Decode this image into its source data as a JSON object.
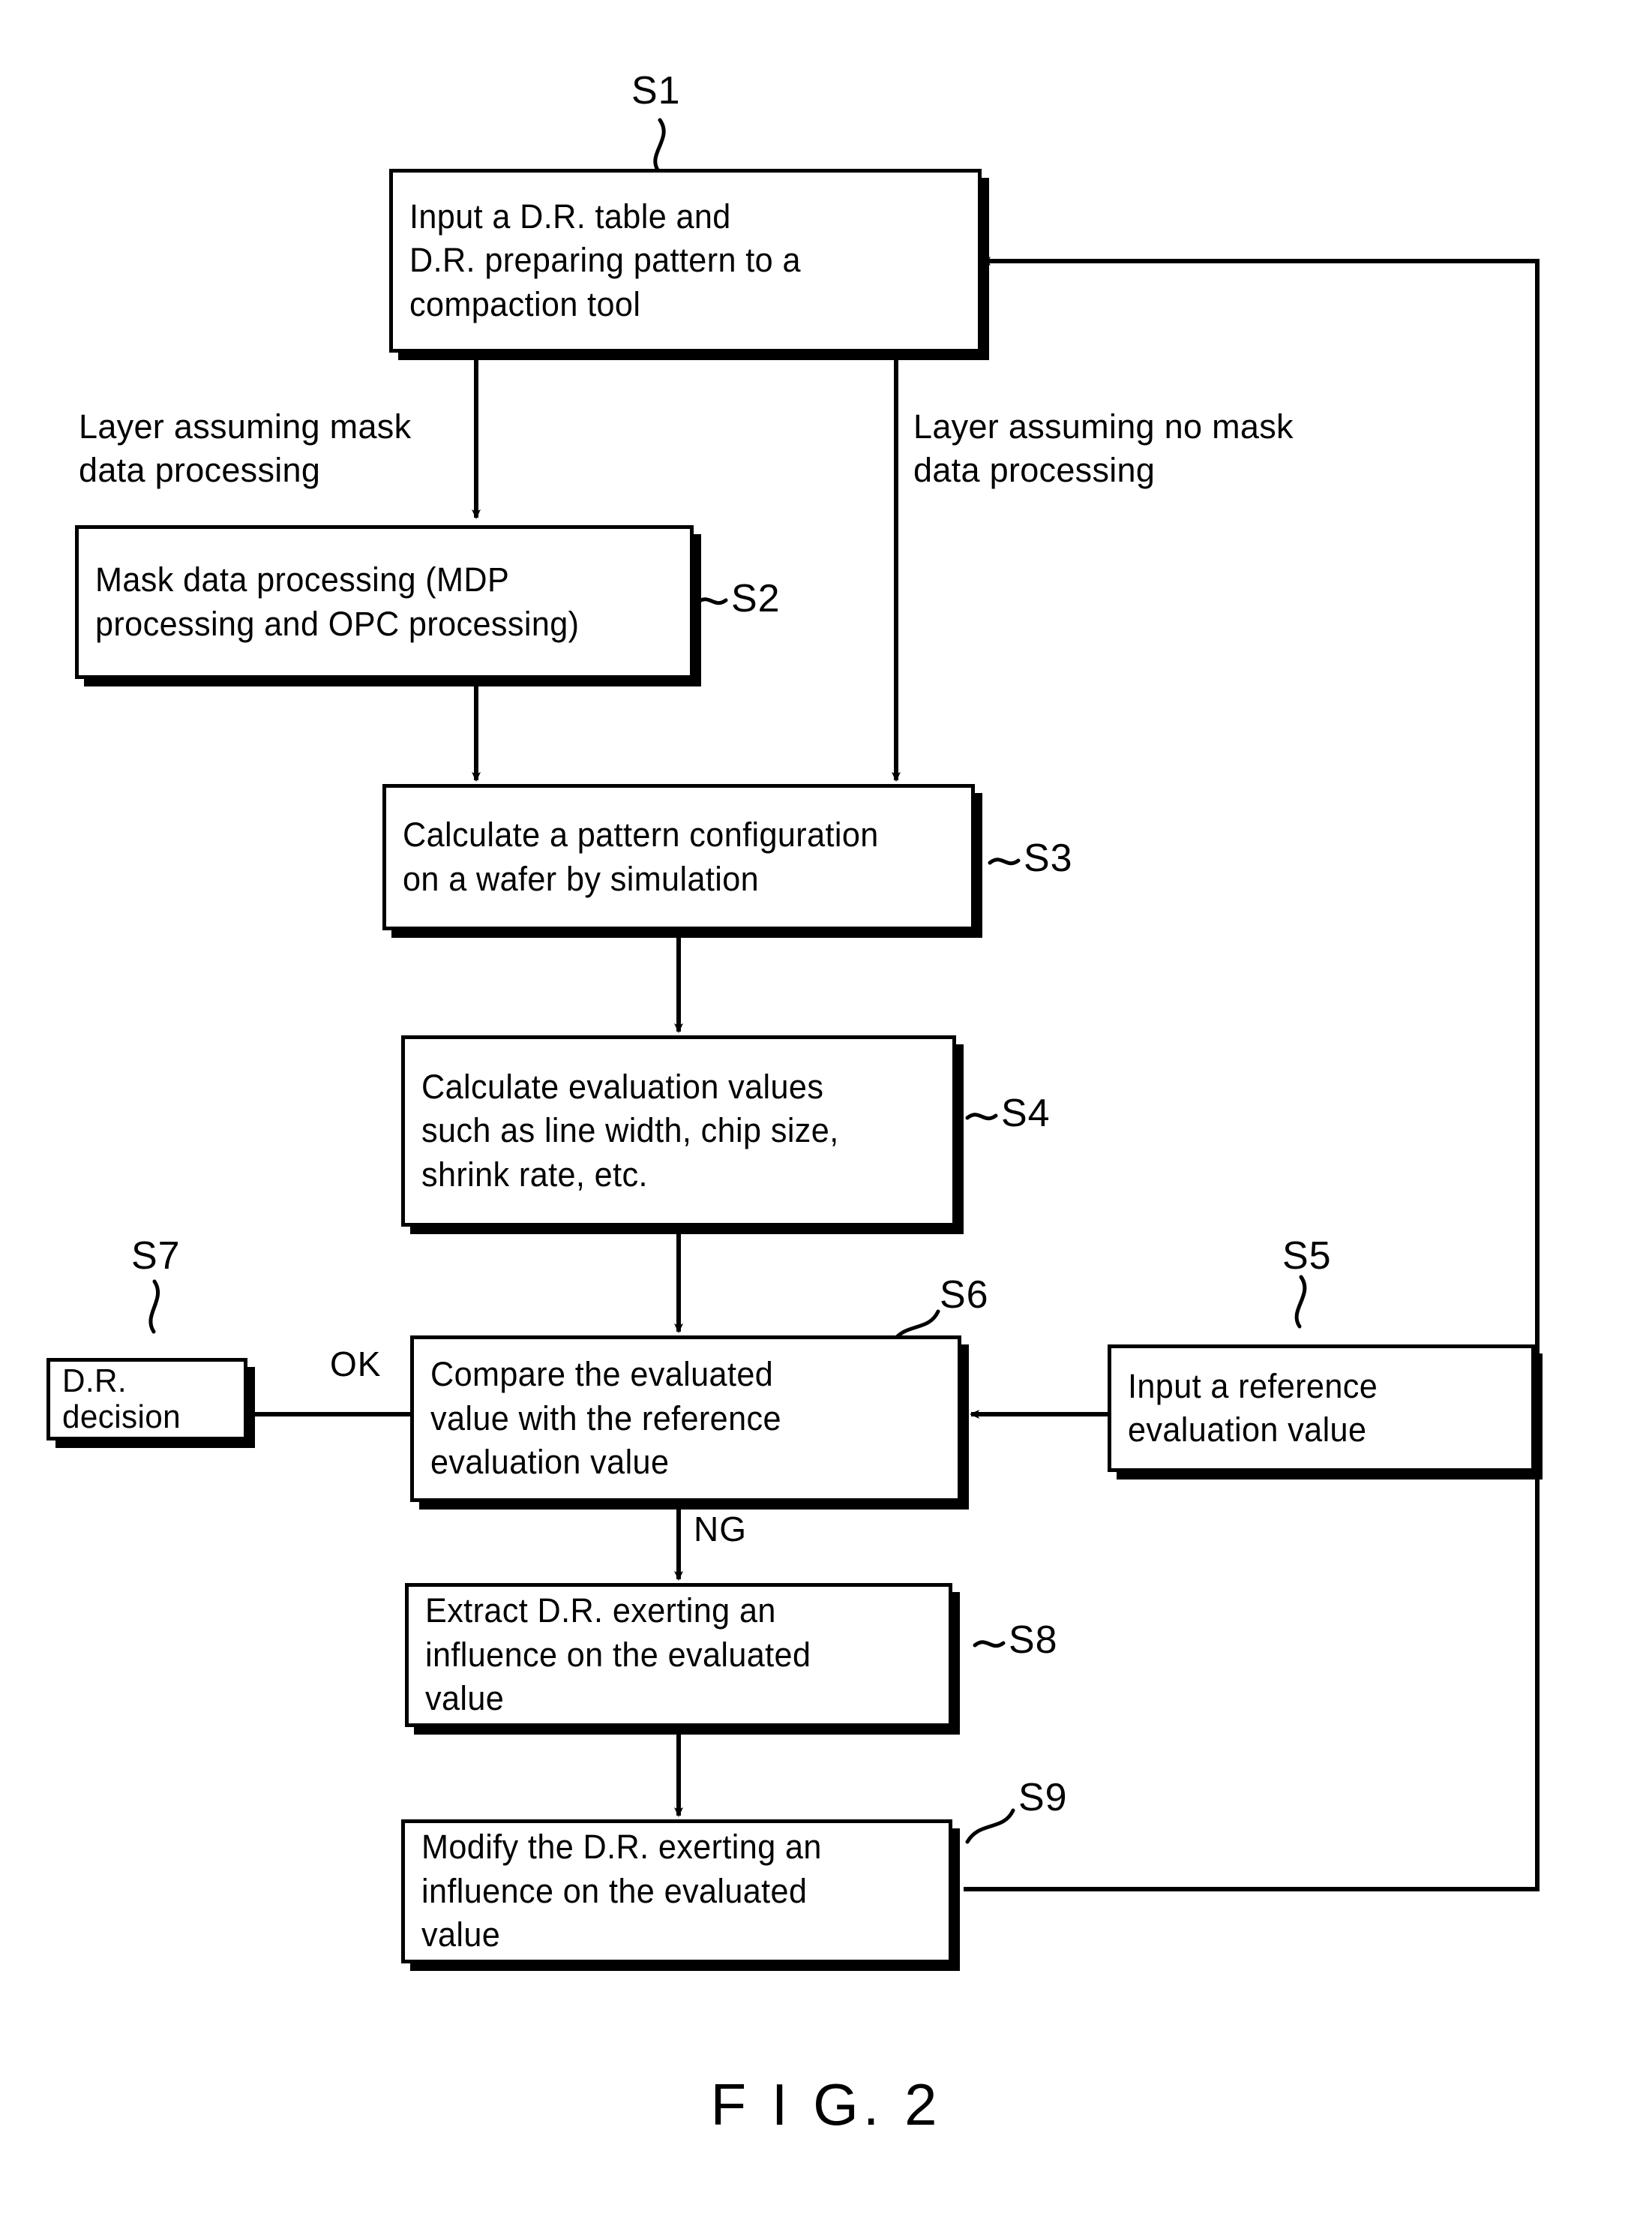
{
  "figure": {
    "caption": "F I G. 2"
  },
  "steps": [
    {
      "id": "S1",
      "label": "S1",
      "text": "Input a D.R. table and\nD.R. preparing pattern to a\ncompaction tool"
    },
    {
      "id": "S2",
      "label": "S2",
      "text": "Mask data processing  (MDP\nprocessing and OPC processing)"
    },
    {
      "id": "S3",
      "label": "S3",
      "text": "Calculate a pattern configuration\non a wafer by simulation"
    },
    {
      "id": "S4",
      "label": "S4",
      "text": "Calculate evaluation values\nsuch  as line width, chip size,\nshrink rate, etc."
    },
    {
      "id": "S5",
      "label": "S5",
      "text": "Input a reference\nevaluation value"
    },
    {
      "id": "S6",
      "label": "S6",
      "text": "Compare the evaluated\nvalue with the reference\nevaluation value"
    },
    {
      "id": "S7",
      "label": "S7",
      "text": "D.R. decision"
    },
    {
      "id": "S8",
      "label": "S8",
      "text": "Extract D.R. exerting an\ninfluence on the evaluated\nvalue"
    },
    {
      "id": "S9",
      "label": "S9",
      "text": "Modify the D.R. exerting an\ninfluence on the evaluated\nvalue"
    }
  ],
  "annotations": {
    "branch_left": "Layer assuming mask\ndata processing",
    "branch_right": "Layer assuming no mask\ndata processing",
    "flag_ok": "OK",
    "flag_ng": "NG"
  },
  "colors": {
    "ink": "#000000",
    "paper": "#ffffff"
  }
}
